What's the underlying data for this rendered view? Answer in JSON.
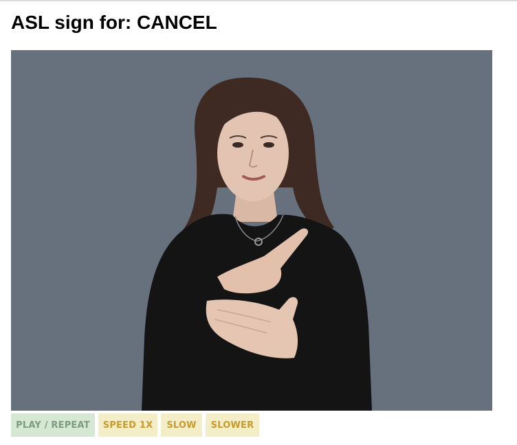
{
  "header": {
    "title": "ASL sign for: CANCEL"
  },
  "video": {
    "icon": "video-frame",
    "background_color": "#67707d"
  },
  "controls": {
    "buttons": [
      {
        "label": "PLAY / REPEAT",
        "background": "#d6e8d4",
        "color": "#7b9a7e"
      },
      {
        "label": "SPEED 1X",
        "background": "#f4eec8",
        "color": "#c99a2c"
      },
      {
        "label": "SLOW",
        "background": "#f4eec8",
        "color": "#c99a2c"
      },
      {
        "label": "SLOWER",
        "background": "#f4eec8",
        "color": "#c99a2c"
      }
    ]
  }
}
